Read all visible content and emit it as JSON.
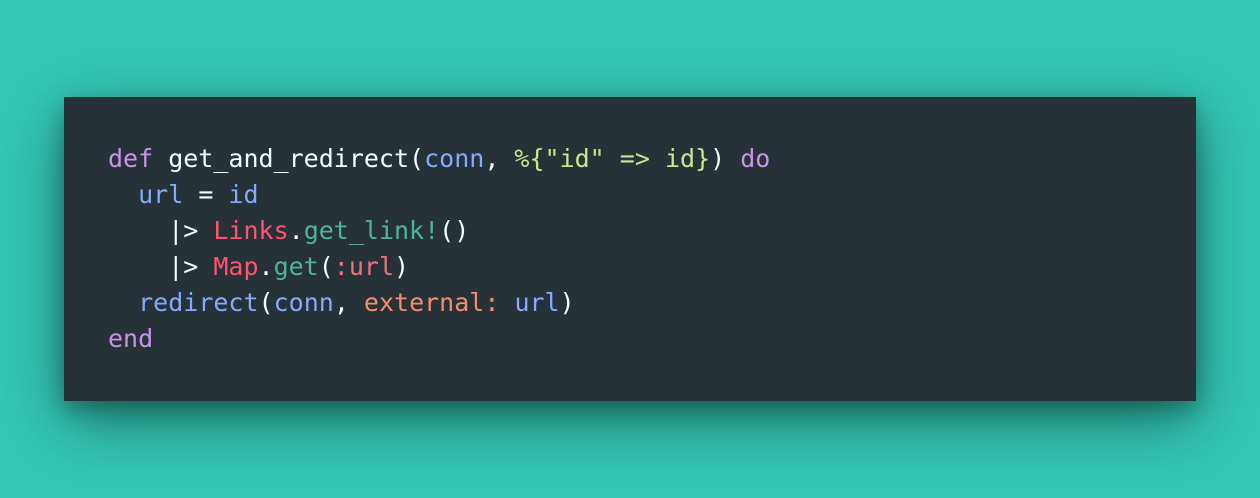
{
  "colors": {
    "background": "#33c9b5",
    "editor_background": "#263238",
    "keyword": "#c792ea",
    "text": "#eeffff",
    "variable": "#82aaff",
    "string": "#c3e88d",
    "module": "#ff5370",
    "function": "#4fb39c",
    "atom": "#f07178",
    "keyword_arg": "#f78c6c"
  },
  "code": {
    "lines": [
      [
        {
          "text": "def",
          "kind": "keyword"
        },
        {
          "text": " get_and_redirect(",
          "kind": "default"
        },
        {
          "text": "conn",
          "kind": "variable"
        },
        {
          "text": ", ",
          "kind": "punct"
        },
        {
          "text": "%{",
          "kind": "sigil"
        },
        {
          "text": "\"id\"",
          "kind": "string"
        },
        {
          "text": " => ",
          "kind": "operator"
        },
        {
          "text": "id",
          "kind": "string"
        },
        {
          "text": "}",
          "kind": "sigil"
        },
        {
          "text": ") ",
          "kind": "punct"
        },
        {
          "text": "do",
          "kind": "keyword"
        }
      ],
      [
        {
          "text": "  ",
          "kind": "default"
        },
        {
          "text": "url",
          "kind": "variable"
        },
        {
          "text": " = ",
          "kind": "punct"
        },
        {
          "text": "id",
          "kind": "variable"
        }
      ],
      [
        {
          "text": "    |> ",
          "kind": "punct"
        },
        {
          "text": "Links",
          "kind": "module"
        },
        {
          "text": ".",
          "kind": "punct"
        },
        {
          "text": "get_link!",
          "kind": "function"
        },
        {
          "text": "()",
          "kind": "punct"
        }
      ],
      [
        {
          "text": "    |> ",
          "kind": "punct"
        },
        {
          "text": "Map",
          "kind": "module"
        },
        {
          "text": ".",
          "kind": "punct"
        },
        {
          "text": "get",
          "kind": "function"
        },
        {
          "text": "(",
          "kind": "punct"
        },
        {
          "text": ":url",
          "kind": "atom"
        },
        {
          "text": ")",
          "kind": "punct"
        }
      ],
      [
        {
          "text": "  ",
          "kind": "default"
        },
        {
          "text": "redirect",
          "kind": "variable"
        },
        {
          "text": "(",
          "kind": "punct"
        },
        {
          "text": "conn",
          "kind": "variable"
        },
        {
          "text": ", ",
          "kind": "punct"
        },
        {
          "text": "external:",
          "kind": "key"
        },
        {
          "text": " ",
          "kind": "punct"
        },
        {
          "text": "url",
          "kind": "variable"
        },
        {
          "text": ")",
          "kind": "punct"
        }
      ],
      [
        {
          "text": "end",
          "kind": "keyword"
        }
      ]
    ]
  }
}
